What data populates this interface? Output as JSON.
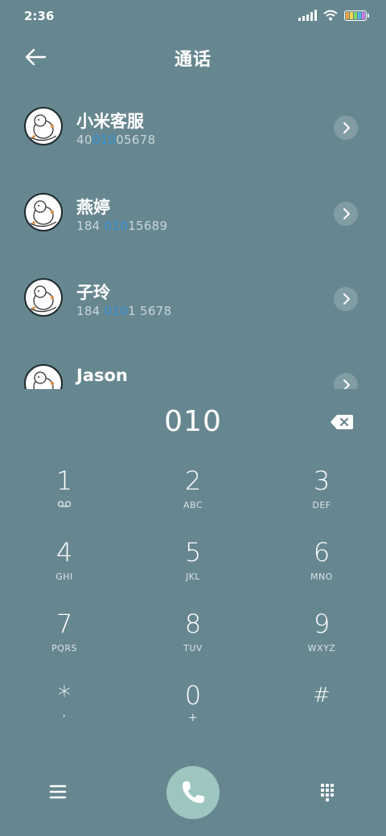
{
  "status_bar": {
    "time": "2:36",
    "icons": [
      "signal-icon",
      "wifi-icon",
      "battery-icon"
    ]
  },
  "header": {
    "title": "通话",
    "back_icon": "back-arrow-icon"
  },
  "contacts": [
    {
      "name": "小米客服",
      "number_pre": "40",
      "number_match": "010",
      "number_post": "05678"
    },
    {
      "name": "燕婷",
      "number_pre": "184 ",
      "number_match": "010",
      "number_post": "15689"
    },
    {
      "name": "子玲",
      "number_pre": "184 ",
      "number_match": "010",
      "number_post": "1 5678"
    },
    {
      "name": "Jason",
      "number_pre": "",
      "number_match": "",
      "number_post": ""
    }
  ],
  "dial": {
    "number": "010",
    "backspace_icon": "backspace-icon"
  },
  "keypad": {
    "keys": [
      {
        "digit": "1",
        "letters": ""
      },
      {
        "digit": "2",
        "letters": "ABC"
      },
      {
        "digit": "3",
        "letters": "DEF"
      },
      {
        "digit": "4",
        "letters": "GHI"
      },
      {
        "digit": "5",
        "letters": "JKL"
      },
      {
        "digit": "6",
        "letters": "MNO"
      },
      {
        "digit": "7",
        "letters": "PQRS"
      },
      {
        "digit": "8",
        "letters": "TUV"
      },
      {
        "digit": "9",
        "letters": "WXYZ"
      },
      {
        "digit": "*",
        "letters": ","
      },
      {
        "digit": "0",
        "letters": "+"
      },
      {
        "digit": "#",
        "letters": ""
      }
    ]
  },
  "bottom_bar": {
    "icons": [
      "menu-icon",
      "phone-icon",
      "dialpad-icon"
    ]
  },
  "colors": {
    "background": "#678790",
    "match_highlight": "#2e8fd8",
    "call_button": "#9ec6c0"
  }
}
